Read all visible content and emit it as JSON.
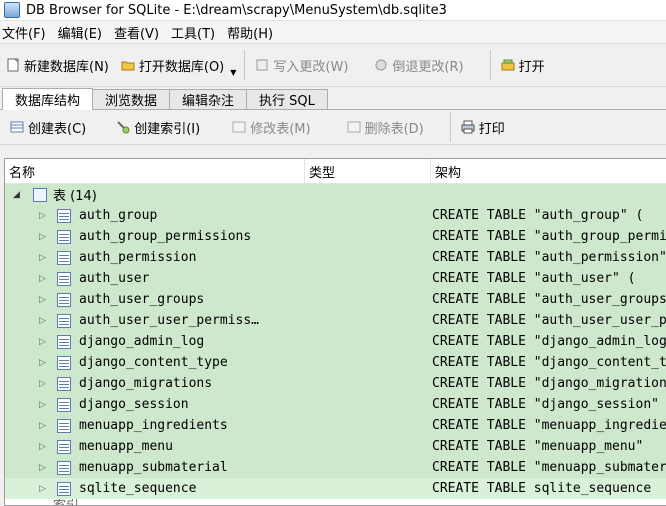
{
  "window": {
    "title": "DB Browser for SQLite - E:\\dream\\scrapy\\MenuSystem\\db.sqlite3"
  },
  "menu": [
    "文件(F)",
    "编辑(E)",
    "查看(V)",
    "工具(T)",
    "帮助(H)"
  ],
  "toolbar": {
    "new_db": "新建数据库(N)",
    "open_db": "打开数据库(O)",
    "write_changes": "写入更改(W)",
    "revert_changes": "倒退更改(R)",
    "open_project": "打开"
  },
  "tabs": [
    "数据库结构",
    "浏览数据",
    "编辑杂注",
    "执行 SQL"
  ],
  "structure_toolbar": {
    "create_table": "创建表(C)",
    "create_index": "创建索引(I)",
    "modify_table": "修改表(M)",
    "delete_table": "删除表(D)",
    "print": "打印"
  },
  "tree": {
    "headers": [
      "名称",
      "类型",
      "架构"
    ],
    "group_label": "表 (14)",
    "rows": [
      {
        "name": "auth_group",
        "schema": "CREATE TABLE \"auth_group\" ("
      },
      {
        "name": "auth_group_permissions",
        "schema": "CREATE TABLE \"auth_group_permissions\""
      },
      {
        "name": "auth_permission",
        "schema": "CREATE TABLE \"auth_permission\""
      },
      {
        "name": "auth_user",
        "schema": "CREATE TABLE \"auth_user\" ("
      },
      {
        "name": "auth_user_groups",
        "schema": "CREATE TABLE \"auth_user_groups\""
      },
      {
        "name": "auth_user_user_permiss…",
        "schema": "CREATE TABLE \"auth_user_user_permissions\""
      },
      {
        "name": "django_admin_log",
        "schema": "CREATE TABLE \"django_admin_log\""
      },
      {
        "name": "django_content_type",
        "schema": "CREATE TABLE \"django_content_type\""
      },
      {
        "name": "django_migrations",
        "schema": "CREATE TABLE \"django_migrations\""
      },
      {
        "name": "django_session",
        "schema": "CREATE TABLE \"django_session\""
      },
      {
        "name": "menuapp_ingredients",
        "schema": "CREATE TABLE \"menuapp_ingredients\""
      },
      {
        "name": "menuapp_menu",
        "schema": "CREATE TABLE \"menuapp_menu\""
      },
      {
        "name": "menuapp_submaterial",
        "schema": "CREATE TABLE \"menuapp_submaterial\""
      },
      {
        "name": "sqlite_sequence",
        "schema": "CREATE TABLE sqlite_sequence"
      }
    ],
    "next_group_partial": "索引"
  }
}
